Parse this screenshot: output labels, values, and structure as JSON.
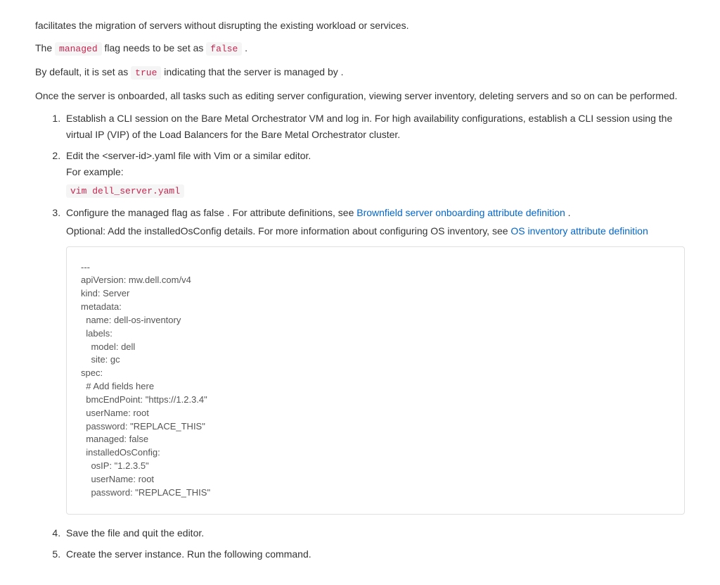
{
  "intro": {
    "p1": "facilitates the migration of servers without disrupting the existing workload or services.",
    "p2_pre": "The ",
    "p2_code": "managed",
    "p2_mid": " flag needs to be set as ",
    "p2_code2": "false",
    "p2_post": " .",
    "p3_pre": "By default, it is set as ",
    "p3_code": "true",
    "p3_post": " indicating that the server is managed by .",
    "p4": "Once the server is onboarded, all tasks such as editing server configuration, viewing server inventory, deleting servers and so on can be performed."
  },
  "steps": {
    "s1": "Establish a CLI session on the Bare Metal Orchestrator VM and log in. For high availability configurations, establish a CLI session using the virtual IP (VIP) of the Load Balancers for the Bare Metal Orchestrator cluster.",
    "s2_a": "Edit the <server-id>.yaml file with Vim or a similar editor.",
    "s2_b": "For example:",
    "s2_cmd": "vim dell_server.yaml",
    "s3_pre": "Configure the managed flag as false . For attribute definitions, see ",
    "s3_link1": "Brownfield server onboarding attribute definition",
    "s3_post": " .",
    "s3_opt_pre": "Optional: Add the installedOsConfig details. For more information about configuring OS inventory, see ",
    "s3_link2": "OS inventory attribute definition",
    "s3_code": "---                \napiVersion: mw.dell.com/v4\nkind: Server\nmetadata:\n  name: dell-os-inventory\n  labels:\n    model: dell\n    site: gc\nspec:\n  # Add fields here\n  bmcEndPoint: \"https://1.2.3.4\"\n  userName: root\n  password: \"REPLACE_THIS\"\n  managed: false\n  installedOsConfig:\n    osIP: \"1.2.3.5\"\n    userName: root\n    password: \"REPLACE_THIS\"",
    "s4": "Save the file and quit the editor.",
    "s5": "Create the server instance. Run the following command."
  }
}
